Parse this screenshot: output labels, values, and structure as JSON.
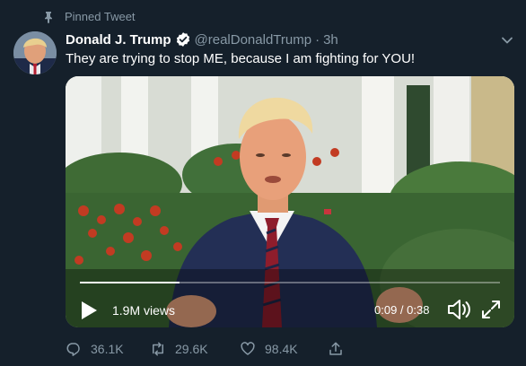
{
  "pinned": {
    "label": "Pinned Tweet",
    "icon": "pin-icon"
  },
  "author": {
    "name": "Donald J. Trump",
    "handle": "@realDonaldTrump",
    "separator": "·",
    "time": "3h",
    "verified_icon": "verified-badge-icon"
  },
  "tweet": {
    "text": "They are trying to stop ME, because I am fighting for YOU!"
  },
  "video": {
    "views": "1.9M views",
    "timecode": "0:09 / 0:38",
    "progress_fraction": 0.237,
    "controls": [
      "play-icon",
      "volume-icon",
      "fullscreen-icon"
    ]
  },
  "actions": {
    "replies": "36.1K",
    "retweets": "29.6K",
    "likes": "98.4K",
    "icons": [
      "reply-icon",
      "retweet-icon",
      "like-icon",
      "share-icon"
    ]
  },
  "colors": {
    "background": "#15202b",
    "muted": "#8899a6",
    "verified": "#ffffff"
  }
}
